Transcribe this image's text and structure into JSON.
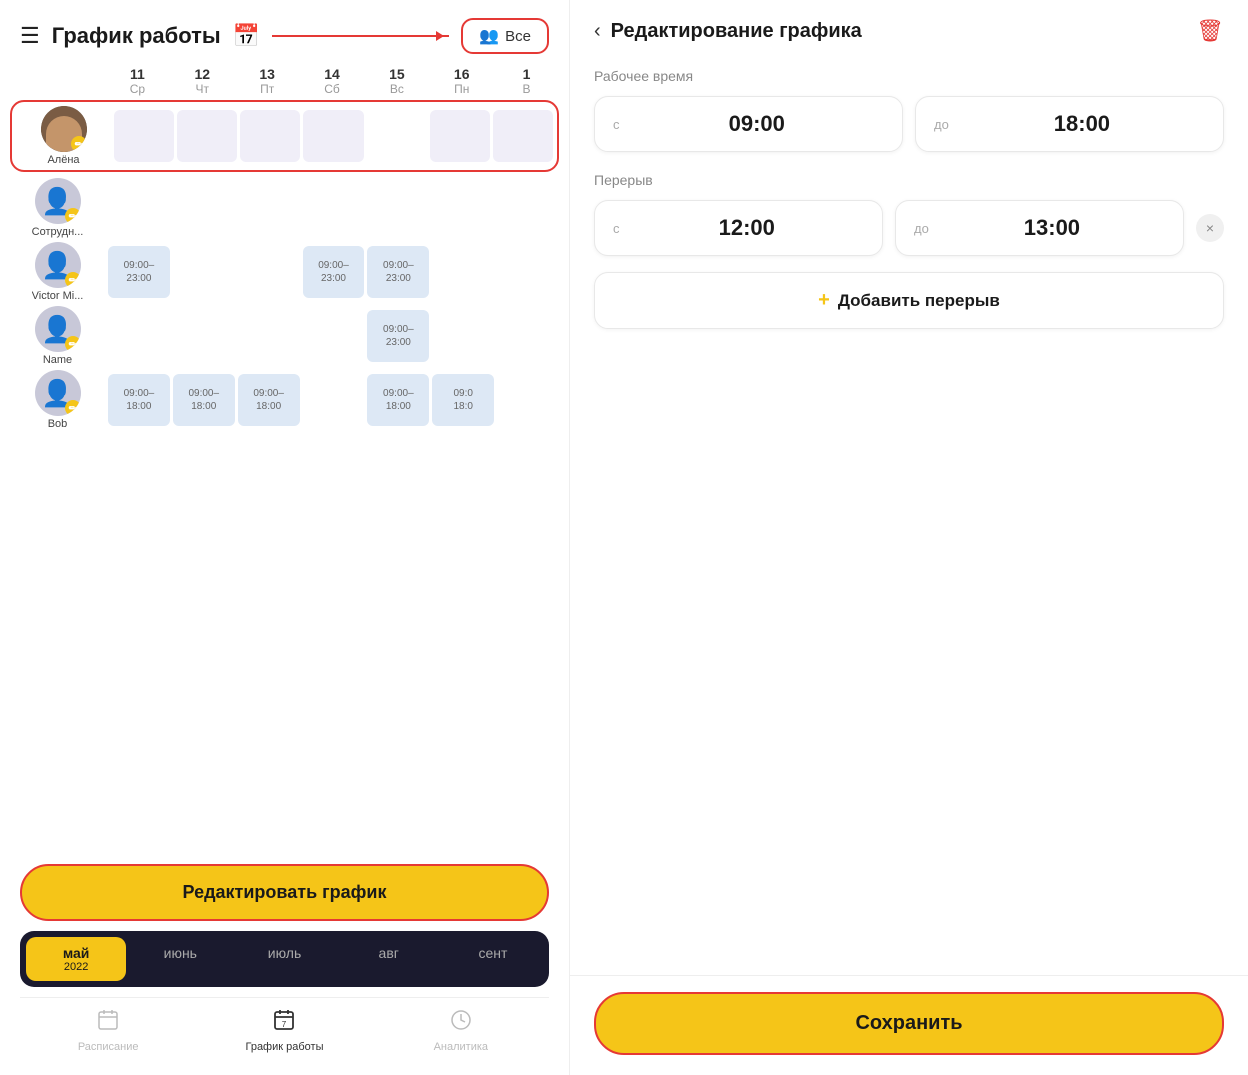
{
  "left": {
    "header": {
      "title": "График работы",
      "filter_label": "Все"
    },
    "days": [
      {
        "num": "11",
        "name": "Ср"
      },
      {
        "num": "12",
        "name": "Чт"
      },
      {
        "num": "13",
        "name": "Пт"
      },
      {
        "num": "14",
        "name": "Сб"
      },
      {
        "num": "15",
        "name": "Вс"
      },
      {
        "num": "16",
        "name": "Пн"
      },
      {
        "num": "1",
        "name": "В"
      }
    ],
    "employees": [
      {
        "name": "Алёна",
        "type": "avatar",
        "selected": true,
        "schedule": [
          "",
          "",
          "",
          "",
          "",
          "",
          ""
        ]
      },
      {
        "name": "Сотрудн...",
        "type": "icon",
        "schedule": [
          "",
          "",
          "",
          "",
          "",
          "",
          ""
        ]
      },
      {
        "name": "Victor Mi...",
        "type": "icon",
        "schedule": [
          "09:00–\n23:00",
          "",
          "",
          "09:00–\n23:00",
          "09:00–\n23:00",
          "",
          ""
        ]
      },
      {
        "name": "Name",
        "type": "icon",
        "schedule": [
          "",
          "",
          "",
          "",
          "09:00–\n23:00",
          "",
          ""
        ]
      },
      {
        "name": "Bob",
        "type": "icon",
        "schedule": [
          "09:00–\n18:00",
          "09:00–\n18:00",
          "09:00–\n18:00",
          "",
          "09:00–\n18:00",
          "09:0\n18:0",
          ""
        ]
      }
    ],
    "edit_btn": "Редактировать график",
    "months": [
      {
        "label": "май",
        "year": "2022",
        "active": true
      },
      {
        "label": "июнь",
        "year": "",
        "active": false
      },
      {
        "label": "июль",
        "year": "",
        "active": false
      },
      {
        "label": "авг",
        "year": "",
        "active": false
      },
      {
        "label": "сент",
        "year": "",
        "active": false
      }
    ],
    "nav": [
      {
        "label": "Расписание",
        "active": false,
        "icon": "📅"
      },
      {
        "label": "График работы",
        "active": true,
        "icon": "📋"
      },
      {
        "label": "Аналитика",
        "active": false,
        "icon": "🕐"
      }
    ]
  },
  "right": {
    "title": "Редактирование графика",
    "work_time_label": "Рабочее время",
    "from_label": "с",
    "to_label": "до",
    "work_start": "09:00",
    "work_end": "18:00",
    "break_label": "Перерыв",
    "break_start": "12:00",
    "break_end": "13:00",
    "add_break_btn": "Добавить перерыв",
    "save_btn": "Сохранить"
  }
}
